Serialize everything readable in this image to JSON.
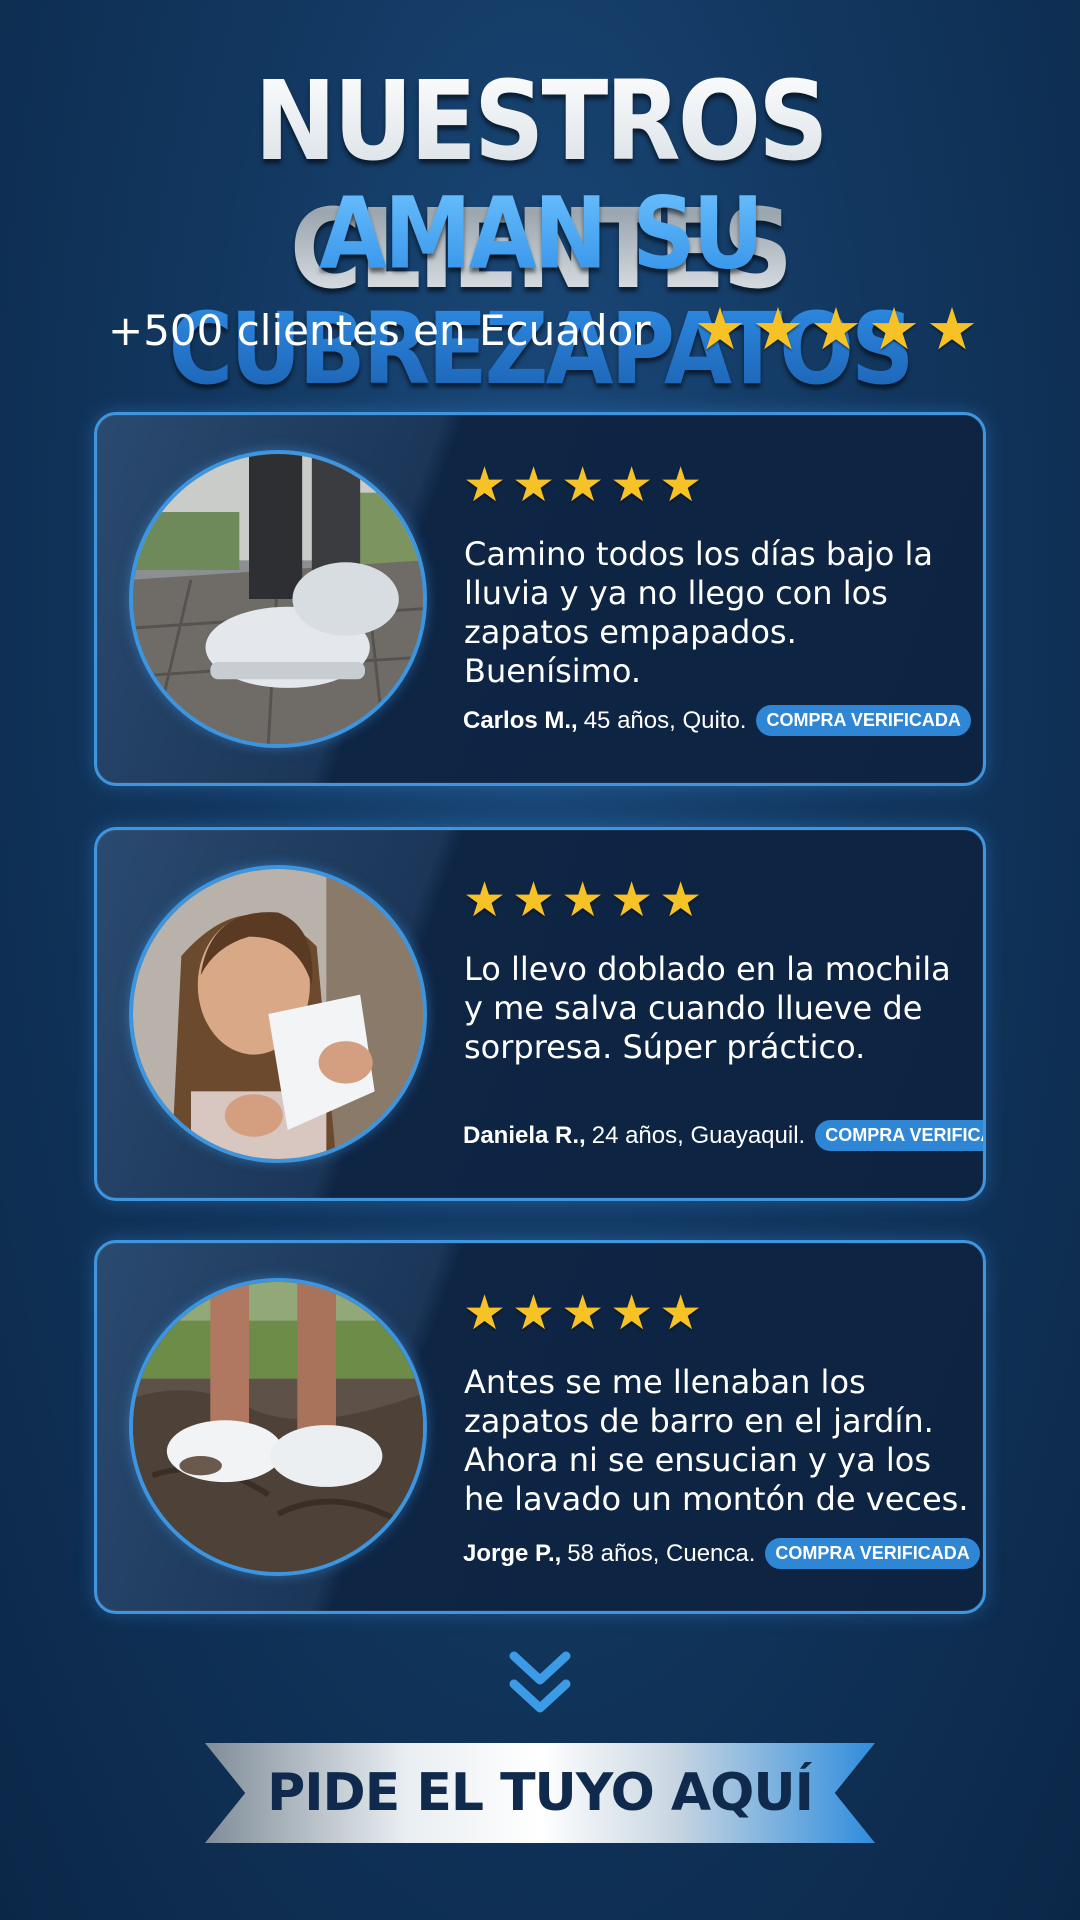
{
  "header": {
    "title_line1": "NUESTROS CLIENTES",
    "title_line2": "AMAN SU CUBREZAPATOS",
    "subtitle": "+500 clientes en Ecuador",
    "rating_stars": 5
  },
  "reviews": [
    {
      "rating": 5,
      "quote": "Camino todos los días bajo la lluvia y ya no llego con los zapatos empapados. Buenísimo.",
      "name": "Carlos M.,",
      "details": "45 años, Quito.",
      "badge": "COMPRA VERIFICADA",
      "photo_icon": "rainy-street-shoe-cover-photo"
    },
    {
      "rating": 5,
      "quote": "Lo llevo doblado en la mochila y me salva cuando llueve de sorpresa. Súper práctico.",
      "name": "Daniela R.,",
      "details": "24 años, Guayaquil.",
      "badge": "COMPRA VERIFICADA",
      "photo_icon": "woman-holding-shoe-cover-photo"
    },
    {
      "rating": 5,
      "quote": "Antes se me llenaban los zapatos de barro en el jardín. Ahora ni se ensucian y ya los he lavado un montón de veces.",
      "name": "Jorge P.,",
      "details": "58 años, Cuenca.",
      "badge": "COMPRA VERIFICADA",
      "photo_icon": "muddy-garden-shoe-cover-photo"
    }
  ],
  "cta": {
    "label": "PIDE EL TUYO AQUÍ",
    "icon": "chevron-double-down-icon"
  },
  "colors": {
    "background": "#12375f",
    "accent": "#3f95de",
    "star": "#f7c226",
    "badge": "#2f86d4"
  }
}
